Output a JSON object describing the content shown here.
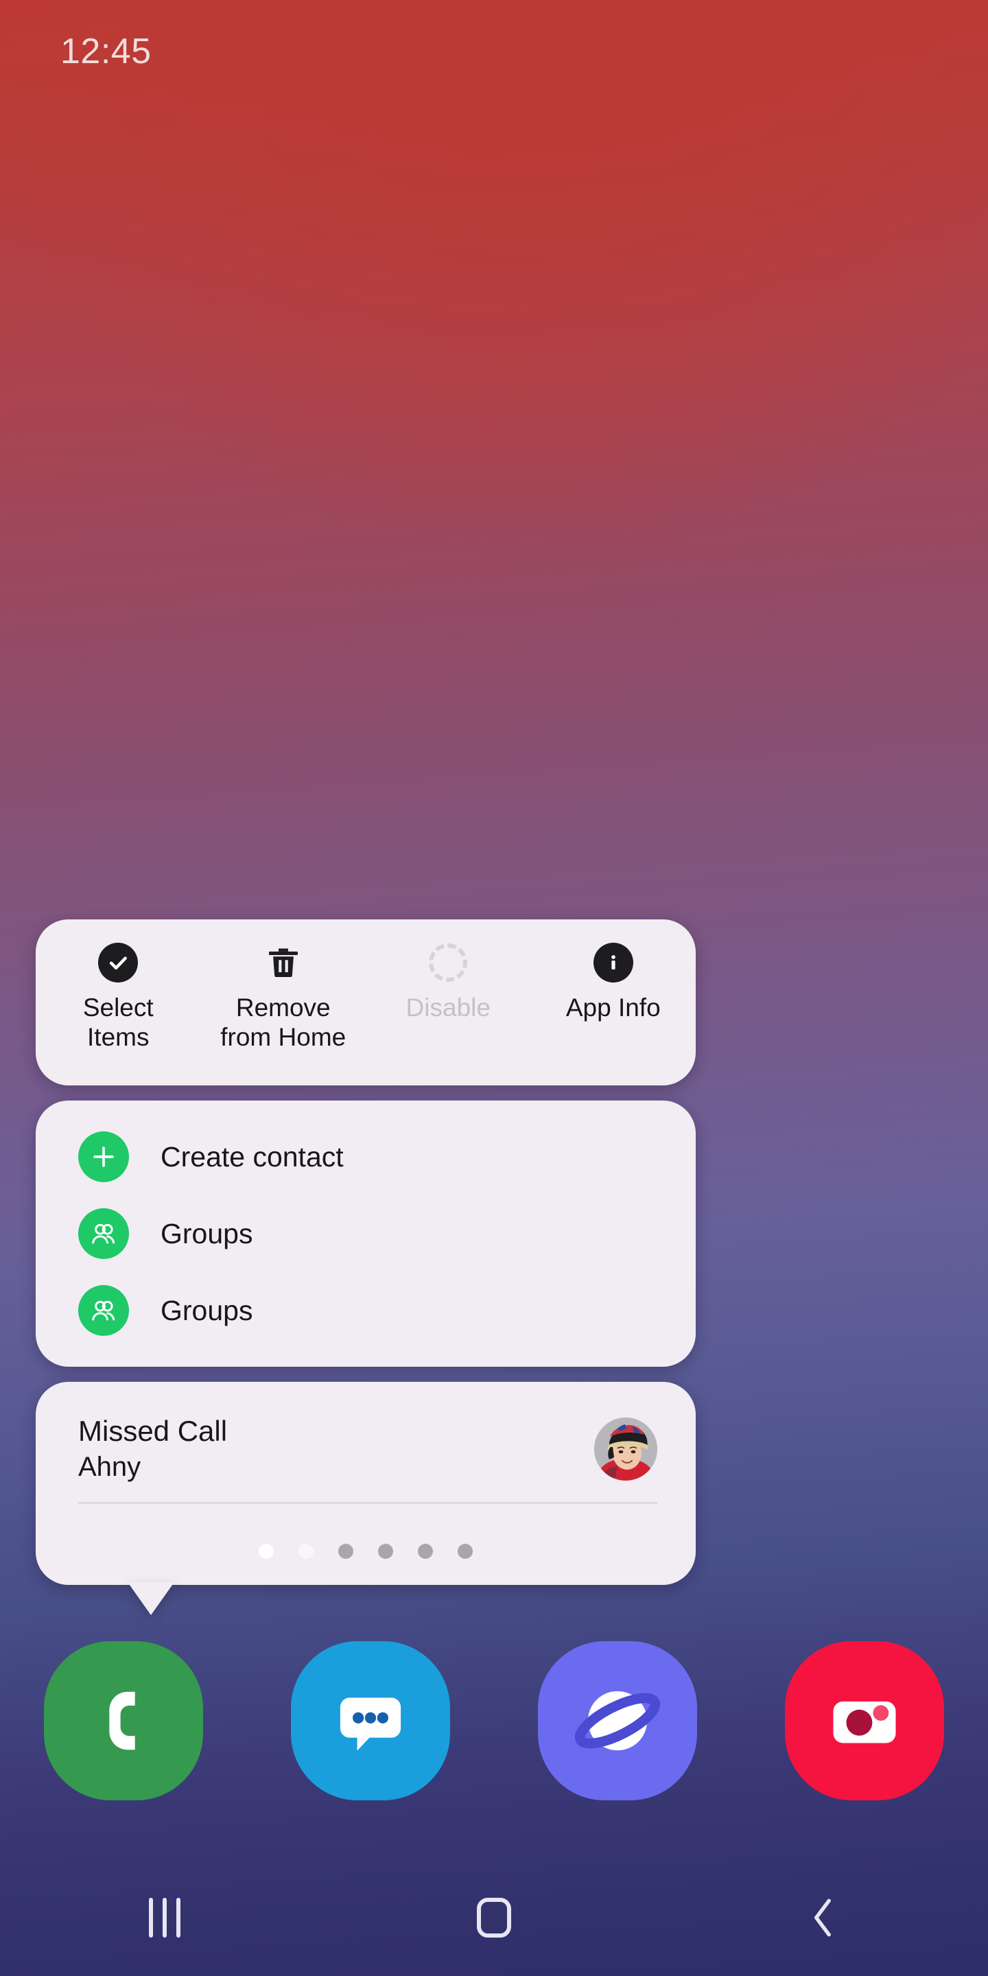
{
  "status_bar": {
    "time": "12:45"
  },
  "popup": {
    "actions": [
      {
        "label": "Select\nItems",
        "icon": "check-circle-icon",
        "disabled": false
      },
      {
        "label": "Remove\nfrom Home",
        "icon": "trash-icon",
        "disabled": false
      },
      {
        "label": "Disable",
        "icon": "dashed-circle-icon",
        "disabled": true
      },
      {
        "label": "App Info",
        "icon": "info-circle-icon",
        "disabled": false
      }
    ],
    "shortcuts": [
      {
        "label": "Create contact",
        "icon": "plus-icon",
        "color": "#1fc968"
      },
      {
        "label": "Groups",
        "icon": "people-icon",
        "color": "#1fc968"
      },
      {
        "label": "Groups",
        "icon": "people-icon",
        "color": "#1fc968"
      }
    ],
    "widget": {
      "title": "Missed Call",
      "subtitle": "Ahny",
      "avatar_alt": "contact-photo",
      "page_dots": [
        "active",
        "semi",
        "inactive",
        "inactive",
        "inactive",
        "inactive"
      ]
    }
  },
  "dock": {
    "items": [
      {
        "name": "phone",
        "label": "Phone",
        "bg": "#35994f",
        "fg": "#ffffff"
      },
      {
        "name": "messages",
        "label": "Messages",
        "bg": "#1a9fdc",
        "fg": "#ffffff"
      },
      {
        "name": "internet",
        "label": "Samsung Internet",
        "bg": "#6b6bf0",
        "fg": "#ffffff"
      },
      {
        "name": "camera",
        "label": "Camera",
        "bg": "#f5143f",
        "fg": "#ffffff"
      }
    ]
  },
  "nav_bar": {
    "recents_label": "Recents",
    "home_label": "Home",
    "back_label": "Back"
  },
  "colors": {
    "card_bg": "#f1edf3",
    "accent_green": "#1fc968",
    "text_primary": "#17171a",
    "text_disabled": "#c4c1c8",
    "status_time": "#f4dcda"
  }
}
